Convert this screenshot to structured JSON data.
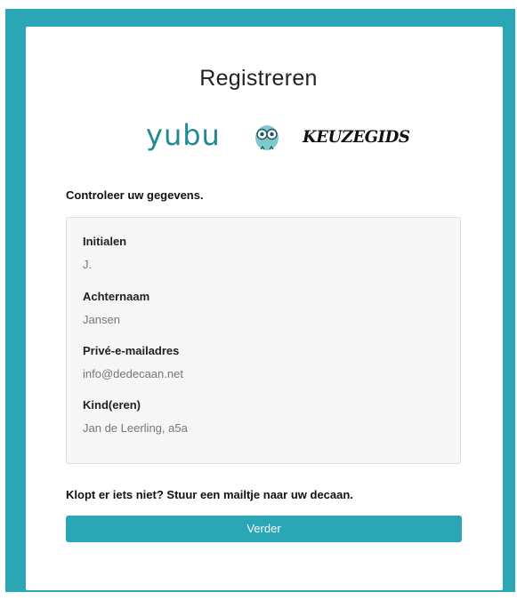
{
  "page": {
    "title": "Registreren"
  },
  "logos": {
    "yubu": "yubu",
    "keuzegids": "KEUZEGIDS",
    "owl_icon": "owl-icon"
  },
  "section": {
    "check_label": "Controleer uw gegevens."
  },
  "fields": [
    {
      "label": "Initialen",
      "value": "J."
    },
    {
      "label": "Achternaam",
      "value": "Jansen"
    },
    {
      "label": "Privé-e-mailadres",
      "value": "info@dedecaan.net"
    },
    {
      "label": "Kind(eren)",
      "value": "Jan de Leerling, a5a"
    }
  ],
  "footer": {
    "contact_text": "Klopt er iets niet? Stuur een mailtje naar uw decaan.",
    "continue_label": "Verder"
  },
  "colors": {
    "accent": "#2aa6b4",
    "yubu": "#1f8a92"
  }
}
